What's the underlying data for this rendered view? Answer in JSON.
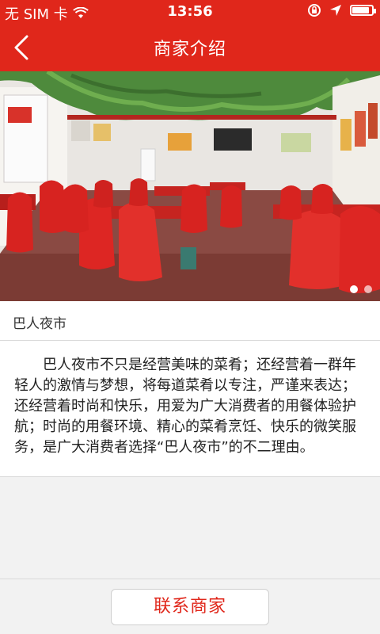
{
  "status_bar": {
    "carrier": "无 SIM 卡",
    "time": "13:56",
    "battery_level": 0.9,
    "icons": [
      "wifi-icon",
      "orientation-lock-icon",
      "location-icon",
      "battery-icon"
    ]
  },
  "header": {
    "title": "商家介绍",
    "back_icon": "chevron-left-icon"
  },
  "gallery": {
    "page_count": 2,
    "active_index": 0
  },
  "merchant": {
    "name": "巴人夜市",
    "description": "巴人夜市不只是经营美味的菜肴；还经营着一群年轻人的激情与梦想，将每道菜肴以专注，严谨来表达；还经营着时尚和快乐，用爱为广大消费者的用餐体验护航；时尚的用餐环境、精心的菜肴烹饪、快乐的微笑服务，是广大消费者选择“巴人夜市”的不二理由。"
  },
  "footer": {
    "contact_label": "联系商家"
  },
  "colors": {
    "brand_red": "#e0271b",
    "background": "#f2f2f2"
  }
}
